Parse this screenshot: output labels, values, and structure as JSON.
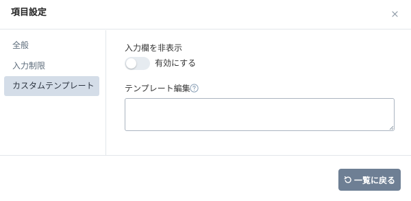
{
  "dialog": {
    "title": "項目設定",
    "close_icon": "close-icon"
  },
  "sidebar": {
    "items": [
      {
        "label": "全般",
        "active": false
      },
      {
        "label": "入力制限",
        "active": false
      },
      {
        "label": "カスタムテンプレート",
        "active": true
      }
    ]
  },
  "content": {
    "hide_field_label": "入力欄を非表示",
    "toggle": {
      "label": "有効にする",
      "enabled": false
    },
    "template_label": "テンプレート編集",
    "help_icon": "question-circle-icon",
    "template_value": ""
  },
  "footer": {
    "back_button_label": "一覧に戻る",
    "back_icon": "undo-icon"
  },
  "colors": {
    "active_bg": "#d4dde8",
    "button_bg": "#6e7f94",
    "divider": "#e2e6ea"
  }
}
